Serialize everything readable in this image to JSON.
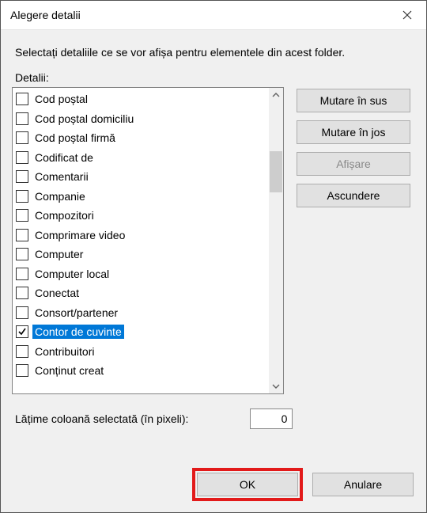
{
  "window": {
    "title": "Alegere detalii",
    "instruction": "Selectați detaliile ce se vor afișa pentru elementele din acest folder.",
    "details_label": "Detalii:"
  },
  "list": {
    "items": [
      {
        "label": "Cod poștal",
        "checked": false,
        "selected": false
      },
      {
        "label": "Cod poștal domiciliu",
        "checked": false,
        "selected": false
      },
      {
        "label": "Cod poștal firmă",
        "checked": false,
        "selected": false
      },
      {
        "label": "Codificat de",
        "checked": false,
        "selected": false
      },
      {
        "label": "Comentarii",
        "checked": false,
        "selected": false
      },
      {
        "label": "Companie",
        "checked": false,
        "selected": false
      },
      {
        "label": "Compozitori",
        "checked": false,
        "selected": false
      },
      {
        "label": "Comprimare video",
        "checked": false,
        "selected": false
      },
      {
        "label": "Computer",
        "checked": false,
        "selected": false
      },
      {
        "label": "Computer local",
        "checked": false,
        "selected": false
      },
      {
        "label": "Conectat",
        "checked": false,
        "selected": false
      },
      {
        "label": "Consort/partener",
        "checked": false,
        "selected": false
      },
      {
        "label": "Contor de cuvinte",
        "checked": true,
        "selected": true
      },
      {
        "label": "Contribuitori",
        "checked": false,
        "selected": false
      },
      {
        "label": "Conținut creat",
        "checked": false,
        "selected": false
      }
    ]
  },
  "side": {
    "move_up": "Mutare în sus",
    "move_down": "Mutare în jos",
    "show": "Afișare",
    "hide": "Ascundere"
  },
  "width": {
    "label": "Lățime coloană selectată (în pixeli):",
    "value": "0"
  },
  "footer": {
    "ok": "OK",
    "cancel": "Anulare"
  }
}
